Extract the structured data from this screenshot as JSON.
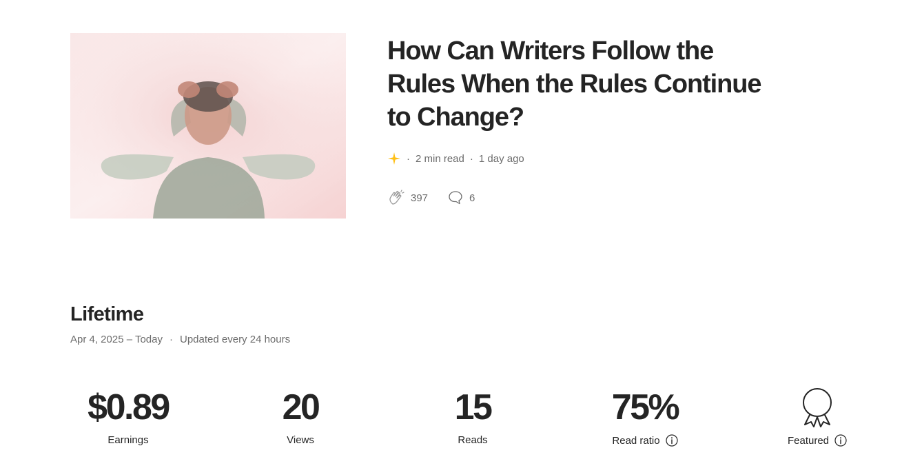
{
  "story": {
    "title": "How Can Writers Follow the Rules When the Rules Continue to Change?",
    "read_time": "2 min read",
    "published": "1 day ago",
    "member_only_icon": "star-icon",
    "claps": "397",
    "responses": "6",
    "accent_color": "#ffc017"
  },
  "stats": {
    "section_title": "Lifetime",
    "date_range": "Apr 4, 2025 – Today",
    "update_note": "Updated every 24 hours",
    "earnings": {
      "value": "$0.89",
      "label": "Earnings"
    },
    "views": {
      "value": "20",
      "label": "Views"
    },
    "reads": {
      "value": "15",
      "label": "Reads"
    },
    "read_ratio": {
      "value": "75%",
      "label": "Read ratio"
    },
    "featured": {
      "label": "Featured",
      "icon": "award-ribbon-icon"
    }
  }
}
